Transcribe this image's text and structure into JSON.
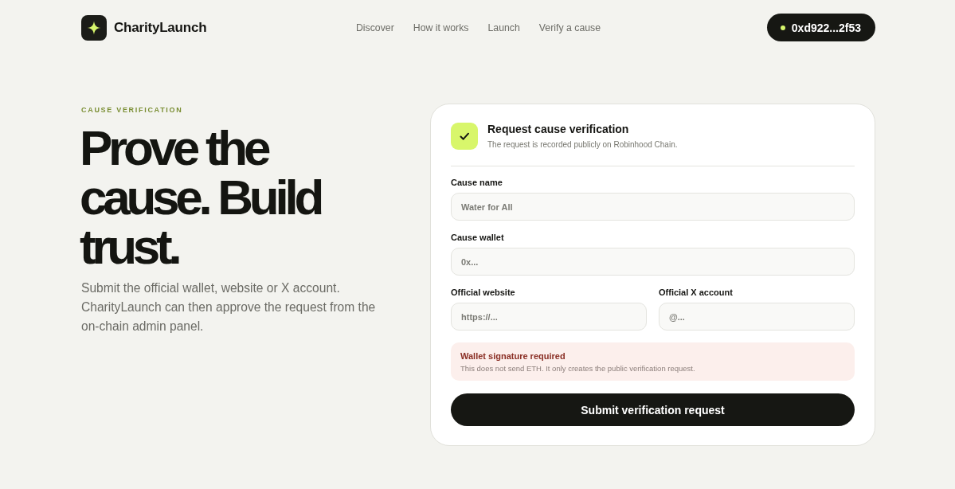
{
  "header": {
    "brand": "CharityLaunch",
    "nav": [
      "Discover",
      "How it works",
      "Launch",
      "Verify a cause"
    ],
    "wallet": "0xd922...2f53"
  },
  "hero": {
    "eyebrow": "CAUSE VERIFICATION",
    "headline": "Prove the cause. Build trust.",
    "description": "Submit the official wallet, website or X account. CharityLaunch can then approve the request from the on-chain admin panel."
  },
  "form": {
    "title": "Request cause verification",
    "subtitle": "The request is recorded publicly on Robinhood Chain.",
    "rows": [
      {
        "fields": [
          {
            "label": "Cause name",
            "placeholder": "Water for All"
          }
        ]
      },
      {
        "fields": [
          {
            "label": "Cause wallet",
            "placeholder": "0x..."
          }
        ]
      },
      {
        "fields": [
          {
            "label": "Official website",
            "placeholder": "https://..."
          },
          {
            "label": "Official X account",
            "placeholder": "@..."
          }
        ]
      }
    ],
    "notice": {
      "title": "Wallet signature required",
      "text": "This does not send ETH. It only creates the public verification request."
    },
    "submit": "Submit verification request"
  }
}
